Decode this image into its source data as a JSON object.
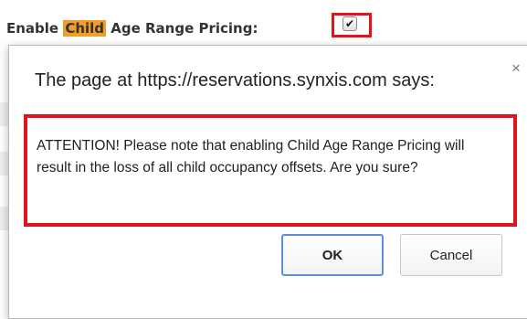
{
  "setting": {
    "label_before": "Enable ",
    "label_highlight": "Child",
    "label_after": " Age Range Pricing:",
    "checked_mark": "✔",
    "checked": true,
    "highlight_color": "#f39c27",
    "outline_color": "#e0141c"
  },
  "dialog": {
    "title": "The page at https://reservations.synxis.com says:",
    "close_glyph": "×",
    "message": "ATTENTION! Please note that enabling Child Age Range Pricing will result in the loss of all child occupancy offsets. Are you sure?",
    "ok_label": "OK",
    "cancel_label": "Cancel",
    "annotation_color": "#e0141c",
    "ok_border_color": "#5d8fe0"
  }
}
